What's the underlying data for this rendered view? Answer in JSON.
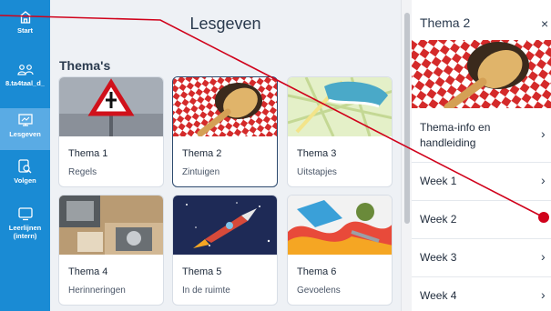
{
  "nav": {
    "items": [
      {
        "label": "Start",
        "icon": "home-icon"
      },
      {
        "label": "8.ta4taal_d_",
        "icon": "group-icon"
      },
      {
        "label": "Lesgeven",
        "icon": "presentation-icon"
      },
      {
        "label": "Volgen",
        "icon": "tablet-search-icon"
      },
      {
        "label": "Leerlijnen (intern)",
        "icon": "monitor-icon"
      }
    ]
  },
  "main": {
    "title": "Lesgeven",
    "section_title": "Thema's",
    "cards": [
      {
        "title": "Thema 1",
        "subtitle": "Regels"
      },
      {
        "title": "Thema 2",
        "subtitle": "Zintuigen"
      },
      {
        "title": "Thema 3",
        "subtitle": "Uitstapjes"
      },
      {
        "title": "Thema 4",
        "subtitle": "Herinneringen"
      },
      {
        "title": "Thema 5",
        "subtitle": "In de ruimte"
      },
      {
        "title": "Thema 6",
        "subtitle": "Gevoelens"
      }
    ]
  },
  "panel": {
    "title": "Thema 2",
    "close": "×",
    "items": [
      {
        "label": "Thema-info en handleiding"
      },
      {
        "label": "Week 1"
      },
      {
        "label": "Week 2"
      },
      {
        "label": "Week 3"
      },
      {
        "label": "Week 4"
      }
    ],
    "chevron": "›"
  },
  "colors": {
    "nav_bg": "#1a8bd4",
    "nav_active": "#5aabe4",
    "main_bg": "#eef1f5",
    "annotation": "#d0021b"
  }
}
